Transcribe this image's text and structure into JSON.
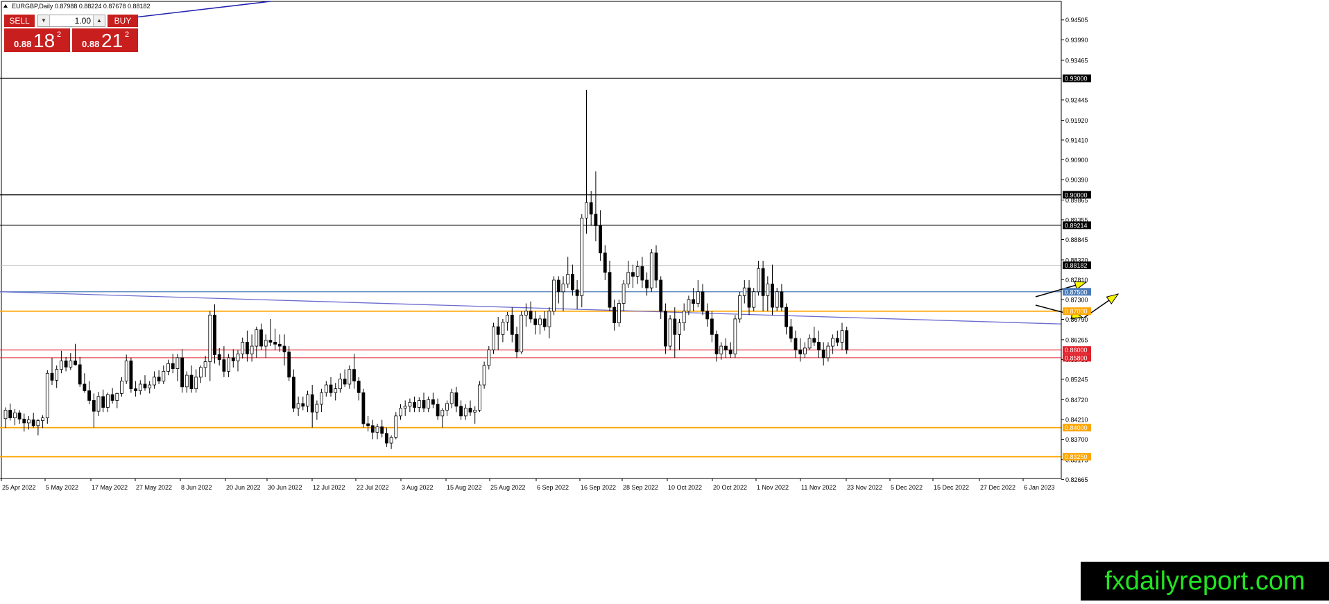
{
  "symbol_header": "EURGBP,Daily  0.87988 0.88224 0.87678 0.88182",
  "trade_panel": {
    "sell_label": "SELL",
    "buy_label": "BUY",
    "lot_value": "1.00",
    "sell_price": {
      "small": "0.88",
      "big": "18",
      "sup": "2"
    },
    "buy_price": {
      "small": "0.88",
      "big": "21",
      "sup": "2"
    }
  },
  "watermark": "fxdailyreport.com",
  "colors": {
    "bull_body": "#ffffff",
    "bear_body": "#000000",
    "orange_level": "#ffa500",
    "red_level": "#e0202a",
    "blue_level": "#4a7ab8",
    "trendline": "#6b6bd0",
    "arrow_fill": "#f5f500"
  },
  "chart_data": {
    "type": "candlestick",
    "symbol": "EURGBP",
    "timeframe": "Daily",
    "ylim": [
      0.8251,
      0.9484
    ],
    "y_ticks": [
      "0.94505",
      "0.93990",
      "0.93465",
      "0.92445",
      "0.91920",
      "0.91410",
      "0.90900",
      "0.90390",
      "0.89865",
      "0.89355",
      "0.88845",
      "0.88320",
      "0.87810",
      "0.87300",
      "0.86790",
      "0.86265",
      "0.85755",
      "0.85245",
      "0.84720",
      "0.84210",
      "0.83700",
      "0.83175",
      "0.82665"
    ],
    "x_labels": [
      "25 Apr 2022",
      "5 May 2022",
      "17 May 2022",
      "27 May 2022",
      "8 Jun 2022",
      "20 Jun 2022",
      "30 Jun 2022",
      "12 Jul 2022",
      "22 Jul 2022",
      "3 Aug 2022",
      "15 Aug 2022",
      "25 Aug 2022",
      "6 Sep 2022",
      "16 Sep 2022",
      "28 Sep 2022",
      "10 Oct 2022",
      "20 Oct 2022",
      "1 Nov 2022",
      "11 Nov 2022",
      "23 Nov 2022",
      "5 Dec 2022",
      "15 Dec 2022",
      "27 Dec 2022",
      "6 Jan 2023"
    ],
    "levels": [
      {
        "price": 0.93,
        "label": "0.93000",
        "style": "black"
      },
      {
        "price": 0.9,
        "label": "0.90000",
        "style": "black"
      },
      {
        "price": 0.89214,
        "label": "0.89214",
        "style": "black"
      },
      {
        "price": 0.88182,
        "label": "0.88182",
        "style": "current"
      },
      {
        "price": 0.875,
        "label": "0.87500",
        "style": "blue"
      },
      {
        "price": 0.87,
        "label": "0.87000",
        "style": "orange"
      },
      {
        "price": 0.86,
        "label": "0.86000",
        "style": "red"
      },
      {
        "price": 0.858,
        "label": "0.85800",
        "style": "red"
      },
      {
        "price": 0.84,
        "label": "0.84000",
        "style": "orange"
      },
      {
        "price": 0.8325,
        "label": "0.83250",
        "style": "orange"
      }
    ],
    "trendlines": [
      {
        "from": [
          "25 Apr 2022",
          0.875
        ],
        "to": [
          "6 Jan 2023+",
          0.8667
        ],
        "color": "#6b6bd0"
      }
    ],
    "candle_count": 184,
    "candles": [
      [
        0.8423,
        0.8452,
        0.8399,
        0.8445
      ],
      [
        0.8445,
        0.8462,
        0.8418,
        0.8425
      ],
      [
        0.8425,
        0.8448,
        0.8406,
        0.8438
      ],
      [
        0.8438,
        0.8445,
        0.841,
        0.8422
      ],
      [
        0.8422,
        0.8436,
        0.839,
        0.8412
      ],
      [
        0.8412,
        0.843,
        0.8395,
        0.842
      ],
      [
        0.842,
        0.8438,
        0.84,
        0.8405
      ],
      [
        0.8405,
        0.8422,
        0.838,
        0.8418
      ],
      [
        0.8418,
        0.8432,
        0.8399,
        0.8425
      ],
      [
        0.8425,
        0.8548,
        0.841,
        0.854
      ],
      [
        0.854,
        0.858,
        0.851,
        0.8522
      ],
      [
        0.8522,
        0.856,
        0.8502,
        0.855
      ],
      [
        0.855,
        0.8598,
        0.854,
        0.8572
      ],
      [
        0.8572,
        0.8582,
        0.8545,
        0.8556
      ],
      [
        0.8556,
        0.8592,
        0.8548,
        0.8572
      ],
      [
        0.8572,
        0.8616,
        0.856,
        0.8562
      ],
      [
        0.8562,
        0.8582,
        0.8505,
        0.8512
      ],
      [
        0.8512,
        0.854,
        0.849,
        0.8495
      ],
      [
        0.8495,
        0.852,
        0.846,
        0.847
      ],
      [
        0.847,
        0.8488,
        0.84,
        0.8442
      ],
      [
        0.8442,
        0.8492,
        0.843,
        0.848
      ],
      [
        0.848,
        0.8498,
        0.844,
        0.8452
      ],
      [
        0.8452,
        0.849,
        0.844,
        0.8485
      ],
      [
        0.8485,
        0.8502,
        0.8462,
        0.847
      ],
      [
        0.847,
        0.849,
        0.845,
        0.8488
      ],
      [
        0.8488,
        0.853,
        0.848,
        0.852
      ],
      [
        0.852,
        0.8588,
        0.8512,
        0.8572
      ],
      [
        0.8572,
        0.858,
        0.849,
        0.85
      ],
      [
        0.85,
        0.852,
        0.848,
        0.8495
      ],
      [
        0.8495,
        0.8522,
        0.8485,
        0.8512
      ],
      [
        0.8512,
        0.8535,
        0.8495,
        0.8502
      ],
      [
        0.8502,
        0.852,
        0.8488,
        0.851
      ],
      [
        0.851,
        0.8545,
        0.85,
        0.853
      ],
      [
        0.853,
        0.8548,
        0.8512,
        0.852
      ],
      [
        0.852,
        0.856,
        0.8512,
        0.8545
      ],
      [
        0.8545,
        0.8575,
        0.8535,
        0.8565
      ],
      [
        0.8565,
        0.859,
        0.854,
        0.8552
      ],
      [
        0.8552,
        0.859,
        0.852,
        0.858
      ],
      [
        0.858,
        0.8602,
        0.849,
        0.8505
      ],
      [
        0.8505,
        0.8545,
        0.849,
        0.8535
      ],
      [
        0.8535,
        0.856,
        0.849,
        0.85
      ],
      [
        0.85,
        0.855,
        0.849,
        0.853
      ],
      [
        0.853,
        0.856,
        0.8515,
        0.8555
      ],
      [
        0.8555,
        0.8585,
        0.853,
        0.857
      ],
      [
        0.857,
        0.87,
        0.852,
        0.869
      ],
      [
        0.869,
        0.8718,
        0.8565,
        0.8588
      ],
      [
        0.8588,
        0.8605,
        0.856,
        0.8575
      ],
      [
        0.8575,
        0.861,
        0.853,
        0.8545
      ],
      [
        0.8545,
        0.859,
        0.853,
        0.858
      ],
      [
        0.858,
        0.8602,
        0.8555,
        0.8572
      ],
      [
        0.8572,
        0.86,
        0.8545,
        0.859
      ],
      [
        0.859,
        0.8632,
        0.8578,
        0.862
      ],
      [
        0.862,
        0.865,
        0.857,
        0.859
      ],
      [
        0.859,
        0.864,
        0.857,
        0.861
      ],
      [
        0.861,
        0.866,
        0.858,
        0.8652
      ],
      [
        0.8652,
        0.8668,
        0.86,
        0.861
      ],
      [
        0.861,
        0.864,
        0.858,
        0.8625
      ],
      [
        0.8625,
        0.868,
        0.861,
        0.862
      ],
      [
        0.862,
        0.8655,
        0.86,
        0.8615
      ],
      [
        0.8615,
        0.864,
        0.8595,
        0.861
      ],
      [
        0.861,
        0.864,
        0.856,
        0.8595
      ],
      [
        0.8595,
        0.861,
        0.852,
        0.853
      ],
      [
        0.853,
        0.855,
        0.844,
        0.845
      ],
      [
        0.845,
        0.848,
        0.843,
        0.8462
      ],
      [
        0.8462,
        0.848,
        0.8445,
        0.8455
      ],
      [
        0.8455,
        0.8495,
        0.844,
        0.8485
      ],
      [
        0.8485,
        0.851,
        0.84,
        0.844
      ],
      [
        0.844,
        0.847,
        0.842,
        0.846
      ],
      [
        0.846,
        0.85,
        0.844,
        0.849
      ],
      [
        0.849,
        0.852,
        0.848,
        0.851
      ],
      [
        0.851,
        0.853,
        0.848,
        0.849
      ],
      [
        0.849,
        0.8515,
        0.847,
        0.85
      ],
      [
        0.85,
        0.854,
        0.849,
        0.8525
      ],
      [
        0.8525,
        0.855,
        0.8505,
        0.8512
      ],
      [
        0.8512,
        0.856,
        0.85,
        0.855
      ],
      [
        0.855,
        0.859,
        0.85,
        0.852
      ],
      [
        0.852,
        0.853,
        0.847,
        0.849
      ],
      [
        0.849,
        0.85,
        0.84,
        0.841
      ],
      [
        0.841,
        0.843,
        0.839,
        0.8405
      ],
      [
        0.8405,
        0.842,
        0.837,
        0.8388
      ],
      [
        0.8388,
        0.841,
        0.837,
        0.8402
      ],
      [
        0.8402,
        0.842,
        0.8375,
        0.8385
      ],
      [
        0.8385,
        0.84,
        0.835,
        0.836
      ],
      [
        0.836,
        0.838,
        0.8345,
        0.8375
      ],
      [
        0.8375,
        0.844,
        0.837,
        0.843
      ],
      [
        0.843,
        0.846,
        0.842,
        0.845
      ],
      [
        0.845,
        0.847,
        0.843,
        0.8455
      ],
      [
        0.8455,
        0.8475,
        0.844,
        0.8465
      ],
      [
        0.8465,
        0.848,
        0.844,
        0.8452
      ],
      [
        0.8452,
        0.8478,
        0.844,
        0.847
      ],
      [
        0.847,
        0.849,
        0.844,
        0.845
      ],
      [
        0.845,
        0.848,
        0.844,
        0.8472
      ],
      [
        0.8472,
        0.849,
        0.845,
        0.846
      ],
      [
        0.846,
        0.8475,
        0.842,
        0.843
      ],
      [
        0.843,
        0.845,
        0.84,
        0.8445
      ],
      [
        0.8445,
        0.847,
        0.843,
        0.8462
      ],
      [
        0.8462,
        0.85,
        0.845,
        0.849
      ],
      [
        0.849,
        0.8505,
        0.844,
        0.8455
      ],
      [
        0.8455,
        0.847,
        0.842,
        0.843
      ],
      [
        0.843,
        0.846,
        0.842,
        0.845
      ],
      [
        0.845,
        0.847,
        0.843,
        0.844
      ],
      [
        0.844,
        0.8455,
        0.841,
        0.8445
      ],
      [
        0.8445,
        0.852,
        0.844,
        0.851
      ],
      [
        0.851,
        0.857,
        0.85,
        0.856
      ],
      [
        0.856,
        0.861,
        0.855,
        0.86
      ],
      [
        0.86,
        0.867,
        0.859,
        0.866
      ],
      [
        0.866,
        0.8685,
        0.86,
        0.864
      ],
      [
        0.864,
        0.868,
        0.862,
        0.8672
      ],
      [
        0.8672,
        0.8698,
        0.865,
        0.869
      ],
      [
        0.869,
        0.871,
        0.862,
        0.864
      ],
      [
        0.864,
        0.866,
        0.858,
        0.8595
      ],
      [
        0.8595,
        0.87,
        0.859,
        0.869
      ],
      [
        0.869,
        0.872,
        0.866,
        0.87
      ],
      [
        0.87,
        0.8725,
        0.867,
        0.868
      ],
      [
        0.868,
        0.87,
        0.864,
        0.8665
      ],
      [
        0.8665,
        0.869,
        0.864,
        0.868
      ],
      [
        0.868,
        0.87,
        0.865,
        0.866
      ],
      [
        0.866,
        0.871,
        0.863,
        0.87
      ],
      [
        0.87,
        0.879,
        0.869,
        0.878
      ],
      [
        0.878,
        0.879,
        0.872,
        0.875
      ],
      [
        0.875,
        0.879,
        0.87,
        0.877
      ],
      [
        0.877,
        0.884,
        0.876,
        0.8795
      ],
      [
        0.8795,
        0.882,
        0.874,
        0.8755
      ],
      [
        0.8755,
        0.878,
        0.8705,
        0.874
      ],
      [
        0.874,
        0.895,
        0.871,
        0.894
      ],
      [
        0.894,
        0.927,
        0.89,
        0.898
      ],
      [
        0.898,
        0.901,
        0.892,
        0.895
      ],
      [
        0.895,
        0.906,
        0.888,
        0.892
      ],
      [
        0.892,
        0.896,
        0.883,
        0.885
      ],
      [
        0.885,
        0.887,
        0.878,
        0.88
      ],
      [
        0.88,
        0.883,
        0.87,
        0.871
      ],
      [
        0.871,
        0.873,
        0.865,
        0.867
      ],
      [
        0.867,
        0.873,
        0.866,
        0.872
      ],
      [
        0.872,
        0.878,
        0.87,
        0.877
      ],
      [
        0.877,
        0.883,
        0.876,
        0.88
      ],
      [
        0.88,
        0.882,
        0.876,
        0.879
      ],
      [
        0.879,
        0.883,
        0.877,
        0.8815
      ],
      [
        0.8815,
        0.884,
        0.876,
        0.878
      ],
      [
        0.878,
        0.88,
        0.874,
        0.876
      ],
      [
        0.876,
        0.886,
        0.875,
        0.885
      ],
      [
        0.885,
        0.887,
        0.876,
        0.878
      ],
      [
        0.878,
        0.879,
        0.868,
        0.87
      ],
      [
        0.87,
        0.872,
        0.859,
        0.861
      ],
      [
        0.861,
        0.869,
        0.86,
        0.868
      ],
      [
        0.868,
        0.871,
        0.858,
        0.864
      ],
      [
        0.864,
        0.868,
        0.86,
        0.867
      ],
      [
        0.867,
        0.872,
        0.865,
        0.87
      ],
      [
        0.87,
        0.874,
        0.869,
        0.873
      ],
      [
        0.873,
        0.876,
        0.87,
        0.872
      ],
      [
        0.872,
        0.878,
        0.871,
        0.875
      ],
      [
        0.875,
        0.877,
        0.869,
        0.87
      ],
      [
        0.87,
        0.872,
        0.866,
        0.868
      ],
      [
        0.868,
        0.87,
        0.862,
        0.864
      ],
      [
        0.864,
        0.865,
        0.857,
        0.859
      ],
      [
        0.859,
        0.862,
        0.8575,
        0.861
      ],
      [
        0.861,
        0.863,
        0.858,
        0.86
      ],
      [
        0.86,
        0.862,
        0.858,
        0.859
      ],
      [
        0.859,
        0.869,
        0.858,
        0.868
      ],
      [
        0.868,
        0.875,
        0.867,
        0.874
      ],
      [
        0.874,
        0.878,
        0.872,
        0.876
      ],
      [
        0.876,
        0.878,
        0.869,
        0.871
      ],
      [
        0.871,
        0.876,
        0.87,
        0.875
      ],
      [
        0.875,
        0.883,
        0.874,
        0.881
      ],
      [
        0.881,
        0.883,
        0.87,
        0.874
      ],
      [
        0.874,
        0.879,
        0.87,
        0.877
      ],
      [
        0.877,
        0.882,
        0.869,
        0.871
      ],
      [
        0.871,
        0.876,
        0.87,
        0.875
      ],
      [
        0.875,
        0.877,
        0.87,
        0.871
      ],
      [
        0.871,
        0.872,
        0.864,
        0.866
      ],
      [
        0.866,
        0.868,
        0.862,
        0.863
      ],
      [
        0.863,
        0.865,
        0.858,
        0.86
      ],
      [
        0.86,
        0.863,
        0.857,
        0.859
      ],
      [
        0.859,
        0.862,
        0.858,
        0.8605
      ],
      [
        0.8605,
        0.864,
        0.86,
        0.863
      ],
      [
        0.863,
        0.866,
        0.861,
        0.862
      ],
      [
        0.862,
        0.865,
        0.858,
        0.86
      ],
      [
        0.86,
        0.862,
        0.856,
        0.858
      ],
      [
        0.858,
        0.862,
        0.857,
        0.861
      ],
      [
        0.861,
        0.864,
        0.859,
        0.863
      ],
      [
        0.863,
        0.865,
        0.861,
        0.862
      ],
      [
        0.862,
        0.867,
        0.86,
        0.865
      ],
      [
        0.865,
        0.866,
        0.859,
        0.86
      ]
    ]
  }
}
